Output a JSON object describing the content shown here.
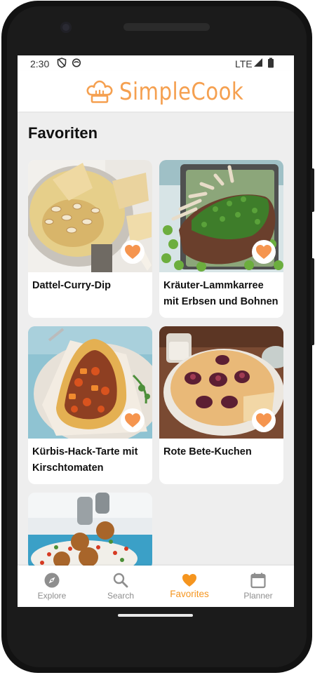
{
  "status": {
    "time": "2:30",
    "network": "LTE"
  },
  "app": {
    "name": "SimpleCook"
  },
  "page": {
    "title": "Favoriten"
  },
  "recipes": [
    {
      "title": "Dattel-Curry-Dip",
      "favorite": true
    },
    {
      "title": "Kräuter-Lammkarree mit Erbsen und Bohnen",
      "favorite": true
    },
    {
      "title": "Kürbis-Hack-Tarte mit Kirschtomaten",
      "favorite": true
    },
    {
      "title": "Rote Bete-Kuchen",
      "favorite": true
    }
  ],
  "nav": {
    "items": [
      {
        "label": "Explore",
        "icon": "compass-icon"
      },
      {
        "label": "Search",
        "icon": "search-icon"
      },
      {
        "label": "Favorites",
        "icon": "heart-icon"
      },
      {
        "label": "Planner",
        "icon": "calendar-icon"
      }
    ],
    "active": "Favorites"
  },
  "colors": {
    "accent": "#f5951f",
    "logo": "#f5a050",
    "background": "#eeeeee",
    "inactive": "#8e8e8e"
  }
}
